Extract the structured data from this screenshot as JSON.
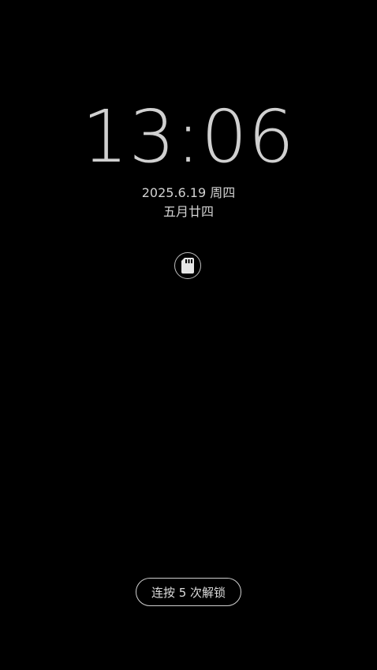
{
  "lockscreen": {
    "time": "13:06",
    "date": "2025.6.19 周四",
    "lunar_date": "五月廿四",
    "notification_icon": "sd-card-icon",
    "unlock_hint": "连按 5 次解锁"
  },
  "colors": {
    "background": "#000000",
    "text": "#d4d4d4"
  }
}
